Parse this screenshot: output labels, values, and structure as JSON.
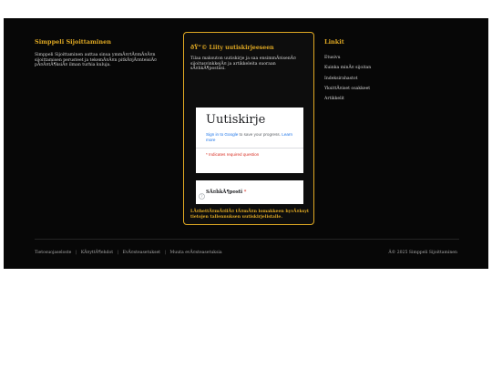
{
  "about": {
    "title": "Simppeli Sijoittaminen",
    "text": "Simppeli Sijoittaminen auttaa sinua ymmÃ¤rtÃ¤mÃ¤Ã¤n sijoittamisen perusteet ja tekemÃ¤Ã¤n pitkÃ¤jÃ¤nteisiÃ¤ pÃ¤Ã¤tÃ¶ksiÃ¤ ilman turhia kuluja."
  },
  "newsletter": {
    "title": "ðŸ“© Liity uutiskirjeeseen",
    "description": "Tilaa maksuton uutiskirje ja saa ensimmÃ¤isenÃ¤ sijoitusvinkkejÃ¤ ja artikkeleita suoraan sÃ¤hkÃ¶postiisi.",
    "form_heading": "Uutiskirje",
    "signin_link": "Sign in to Google",
    "signin_rest": " to save your progress. ",
    "learn_more": "Learn more",
    "required_note": "* Indicates required question",
    "email_label": "SÃ¤hkÃ¶posti",
    "email_required_mark": " *",
    "consent_note": "LÃ¤hettÃ¤mÃ¤llÃ¤ tÃ¤mÃ¤n lomakkeen hyvÃ¤ksyt tietojen tallennuksen uutiskirjelistalle."
  },
  "links": {
    "title": "Linkit",
    "items": [
      "Etusivu",
      "Kuinka minÃ¤ sijoitan",
      "Indeksirahastot",
      "YksittÃ¤iset osakkeet",
      "Artikkelit"
    ]
  },
  "bottom": {
    "links": [
      "Tietosuojaseloste",
      "KÃ¤yttÃ¶ehdot",
      "EvÃ¤steasetukset",
      "Muuta evÃ¤steasetuksia"
    ],
    "separator": "|",
    "copyright": "Â© 2025 Simppeli Sijoittaminen"
  },
  "colors": {
    "background": "#070707",
    "accent": "#e0a923",
    "text": "#d8d8d8",
    "link_blue": "#1a73e8",
    "required_red": "#d93025"
  }
}
